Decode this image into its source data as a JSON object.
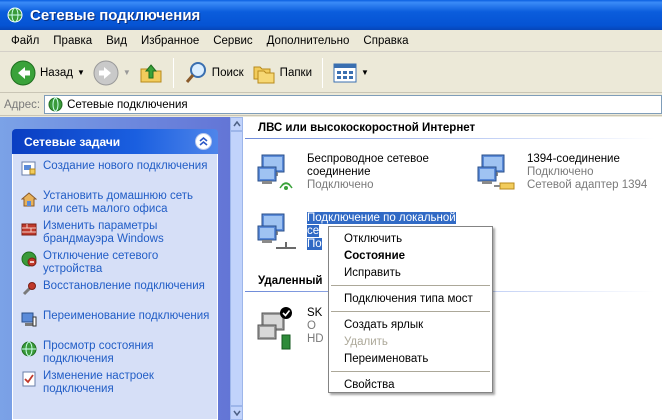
{
  "window": {
    "title": "Сетевые подключения"
  },
  "menu": [
    "Файл",
    "Правка",
    "Вид",
    "Избранное",
    "Сервис",
    "Дополнительно",
    "Справка"
  ],
  "toolbar": {
    "back": "Назад",
    "search": "Поиск",
    "folders": "Папки"
  },
  "address": {
    "label": "Адрес:",
    "value": "Сетевые подключения"
  },
  "tasks": {
    "title": "Сетевые задачи",
    "items": [
      "Создание нового подключения",
      "Установить домашнюю сеть или сеть малого офиса",
      "Изменить параметры брандмауэра Windows",
      "Отключение сетевого устройства",
      "Восстановление подключения",
      "Переименование подключения",
      "Просмотр состояния подключения",
      "Изменение настроек подключения"
    ]
  },
  "groups": {
    "lan": "ЛВС или высокоскоростной Интернет",
    "remote": "Удаленный"
  },
  "connections": {
    "wireless": {
      "name1": "Беспроводное сетевое",
      "name2": "соединение",
      "status": "Подключено"
    },
    "ieee1394": {
      "name": "1394-соединение",
      "status": "Подключено",
      "device": "Сетевой адаптер 1394"
    },
    "local": {
      "name": "Подключение по локальной",
      "line2": "се",
      "line3": "По"
    },
    "skype": {
      "line1": "SK",
      "line2": "О",
      "line3": "HD"
    }
  },
  "context_menu": {
    "disconnect": "Отключить",
    "status": "Состояние",
    "repair": "Исправить",
    "bridge": "Подключения типа мост",
    "shortcut": "Создать ярлык",
    "delete": "Удалить",
    "rename": "Переименовать",
    "properties": "Свойства"
  }
}
